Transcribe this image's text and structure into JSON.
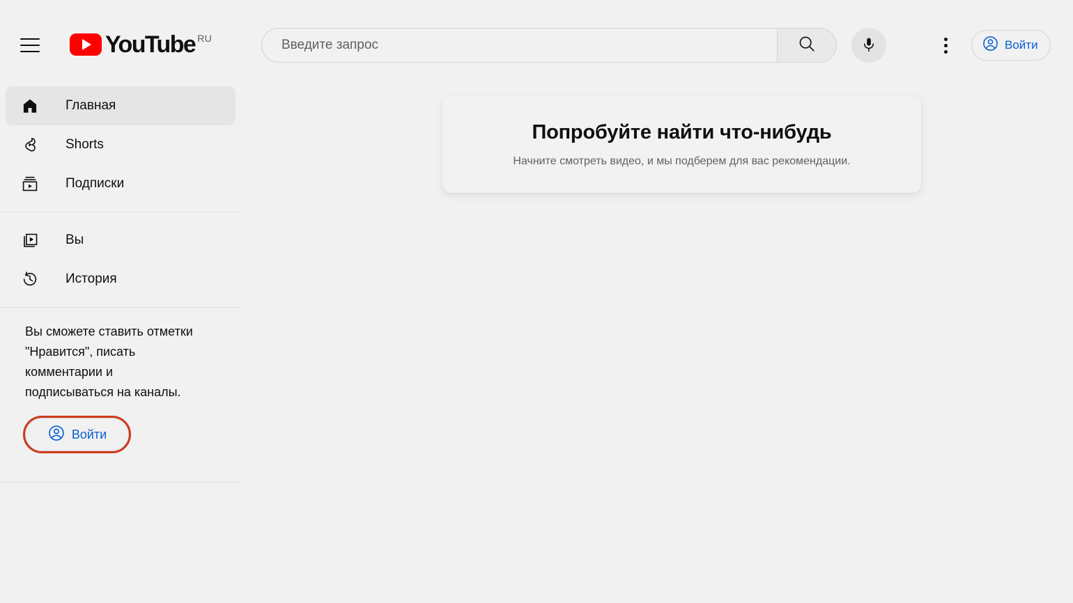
{
  "header": {
    "menu_icon": "hamburger-menu-icon",
    "logo_text": "YouTube",
    "logo_country": "RU",
    "logo_icon": "youtube-play-logo-icon",
    "search": {
      "value": "",
      "placeholder": "Введите запрос",
      "button_icon": "search-icon"
    },
    "voice_search_icon": "microphone-icon",
    "settings_icon": "more-vertical-icon",
    "signin": {
      "label": "Войти",
      "icon": "account-circle-icon"
    }
  },
  "sidebar": {
    "primary": [
      {
        "label": "Главная",
        "icon": "home-icon",
        "active": true
      },
      {
        "label": "Shorts",
        "icon": "shorts-icon",
        "active": false
      },
      {
        "label": "Подписки",
        "icon": "subscriptions-icon",
        "active": false
      }
    ],
    "secondary": [
      {
        "label": "Вы",
        "icon": "you-library-icon",
        "active": false
      },
      {
        "label": "История",
        "icon": "history-clock-icon",
        "active": false
      }
    ],
    "promo": {
      "text": "Вы сможете ставить отметки \"Нравится\", писать комментарии и подписываться на каналы.",
      "signin_label": "Войти",
      "signin_icon": "account-circle-icon",
      "highlight_color": "#cc3a1b"
    }
  },
  "main": {
    "empty_state": {
      "title": "Попробуйте найти что-нибудь",
      "subtitle": "Начните смотреть видео, и мы подберем для вас рекомендации."
    }
  },
  "colors": {
    "background": "#f1f1f1",
    "brand_red": "#ff0000",
    "link_blue": "#065fd4",
    "text_primary": "#0f0f0f",
    "text_secondary": "#606060",
    "active_pill": "#e5e5e5",
    "divider": "#e0e0e0",
    "annotation_red": "#cc3a1b"
  }
}
